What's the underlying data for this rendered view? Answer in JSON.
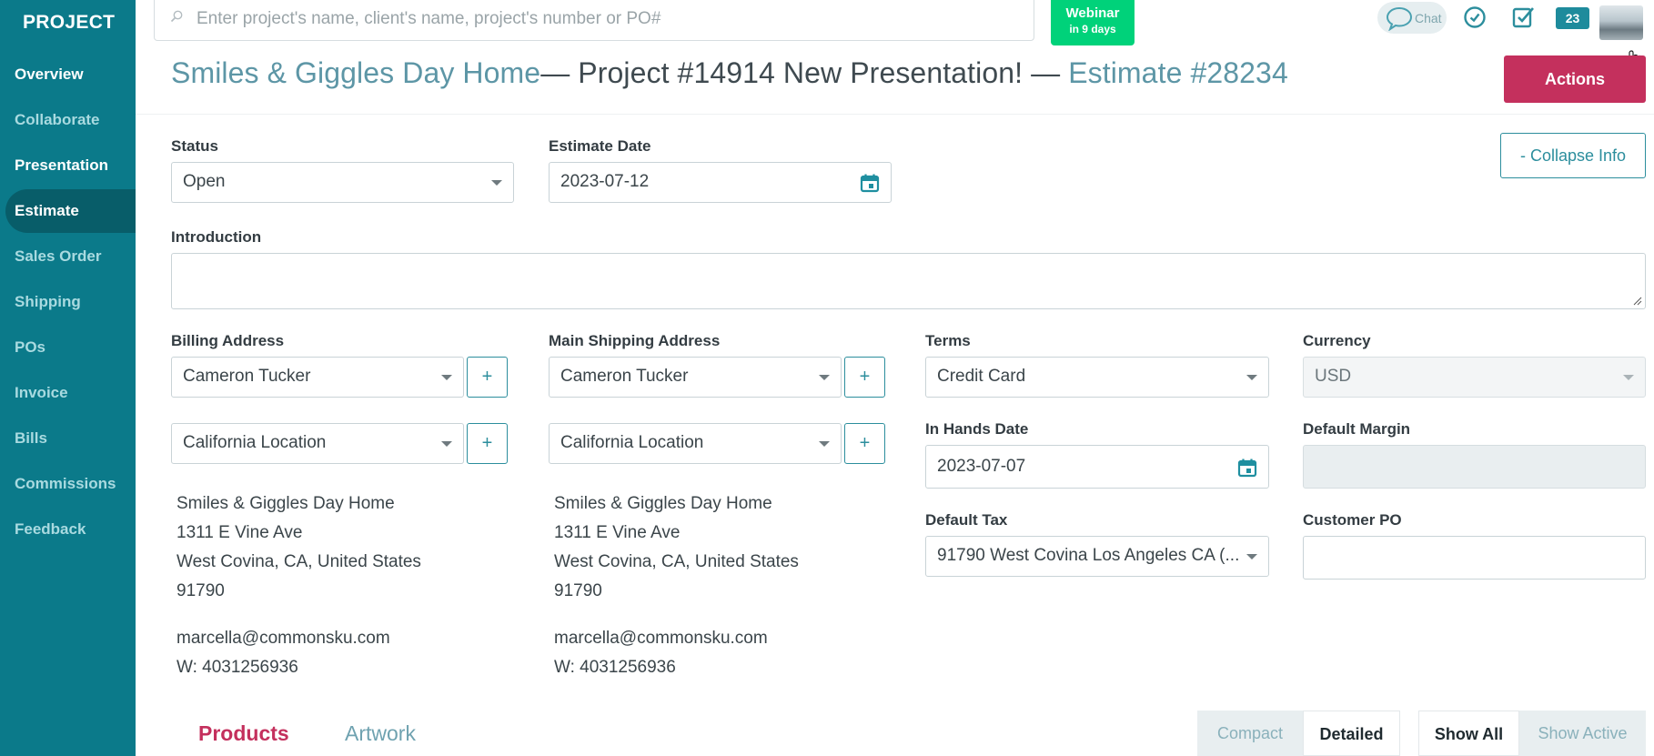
{
  "sidebar": {
    "brand": "PROJECT",
    "items": [
      {
        "label": "Overview"
      },
      {
        "label": "Collaborate"
      },
      {
        "label": "Presentation"
      },
      {
        "label": "Estimate"
      },
      {
        "label": "Sales Order"
      },
      {
        "label": "Shipping"
      },
      {
        "label": "POs"
      },
      {
        "label": "Invoice"
      },
      {
        "label": "Bills"
      },
      {
        "label": "Commissions"
      },
      {
        "label": "Feedback"
      }
    ],
    "active": "Estimate"
  },
  "topbar": {
    "search_placeholder": "Enter project's name, client's name, project's number or PO#",
    "webinar_title": "Webinar",
    "webinar_sub": "in 9 days",
    "chat_label": "Chat",
    "notification_count": "23"
  },
  "header": {
    "client": "Smiles & Giggles Day Home",
    "project": "— Project #14914 New Presentation! — ",
    "estimate": "Estimate #28234",
    "actions_label": "Actions"
  },
  "form": {
    "status_label": "Status",
    "status_value": "Open",
    "estimate_date_label": "Estimate Date",
    "estimate_date_value": "2023-07-12",
    "collapse_label": "- Collapse Info",
    "introduction_label": "Introduction",
    "billing_label": "Billing Address",
    "billing_contact": "Cameron Tucker",
    "billing_location": "California Location",
    "shipping_label": "Main Shipping Address",
    "shipping_contact": "Cameron Tucker",
    "shipping_location": "California Location",
    "terms_label": "Terms",
    "terms_value": "Credit Card",
    "currency_label": "Currency",
    "currency_value": "USD",
    "in_hands_label": "In Hands Date",
    "in_hands_value": "2023-07-07",
    "default_margin_label": "Default Margin",
    "default_tax_label": "Default Tax",
    "default_tax_value": "91790 West Covina Los Angeles CA (...",
    "customer_po_label": "Customer PO",
    "plus": "+"
  },
  "billing_address": {
    "name": "Smiles & Giggles Day Home",
    "street": "1311 E Vine Ave",
    "city": "West Covina, CA, United States",
    "zip": "91790",
    "email": "marcella@commonsku.com",
    "phone": "W: 4031256936"
  },
  "shipping_address": {
    "name": "Smiles & Giggles Day Home",
    "street": "1311 E Vine Ave",
    "city": "West Covina, CA, United States",
    "zip": "91790",
    "email": "marcella@commonsku.com",
    "phone": "W: 4031256936"
  },
  "tabs": {
    "products": "Products",
    "artwork": "Artwork",
    "compact": "Compact",
    "detailed": "Detailed",
    "show_all": "Show All",
    "show_active": "Show Active"
  },
  "colors": {
    "sidebar": "#0b7a8a",
    "accent": "#c4305d",
    "teal": "#2c8e9d",
    "webinar": "#00d27a"
  }
}
